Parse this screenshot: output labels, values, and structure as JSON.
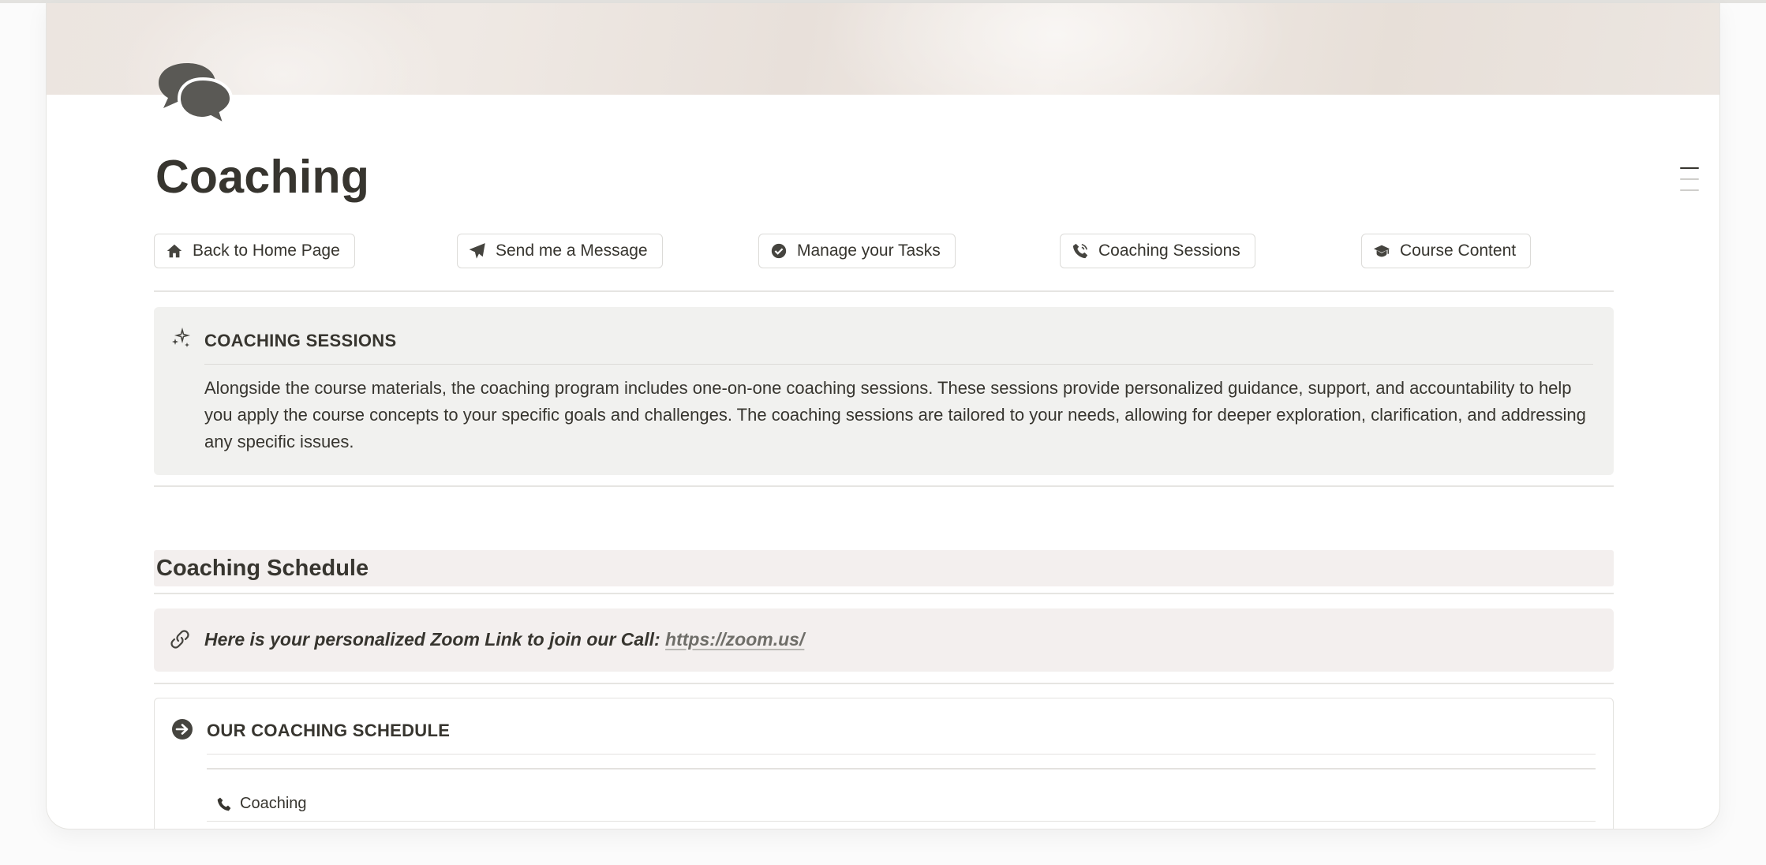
{
  "page": {
    "title": "Coaching",
    "icon": "speech-bubbles-icon"
  },
  "nav_buttons": [
    {
      "label": "Back to Home Page",
      "icon": "home-icon"
    },
    {
      "label": "Send me a Message",
      "icon": "paper-plane-icon"
    },
    {
      "label": "Manage your Tasks",
      "icon": "check-circle-icon"
    },
    {
      "label": "Coaching Sessions",
      "icon": "phone-icon"
    },
    {
      "label": "Course Content",
      "icon": "graduation-cap-icon"
    }
  ],
  "sessions_callout": {
    "icon": "sparkles-icon",
    "heading": "COACHING SESSIONS",
    "body": "Alongside the course materials, the coaching program includes one-on-one coaching sessions. These sessions provide personalized guidance, support, and accountability to help you apply the course concepts to your specific goals and challenges. The coaching sessions are tailored to your needs, allowing for deeper exploration, clarification, and addressing any specific issues."
  },
  "schedule_heading": "Coaching Schedule",
  "zoom_callout": {
    "icon": "link-icon",
    "text": "Here is your personalized Zoom Link to join our Call: ",
    "link": "https://zoom.us/"
  },
  "schedule_box": {
    "icon": "arrow-circle-right-icon",
    "heading": "OUR COACHING SCHEDULE",
    "rows": [
      {
        "label": "Coaching",
        "icon": "phone-icon"
      }
    ]
  },
  "colors": {
    "text": "#37352f",
    "callout_gray": "#f1f1ef",
    "callout_brown": "#f3efee",
    "border": "#e6e5e2"
  }
}
